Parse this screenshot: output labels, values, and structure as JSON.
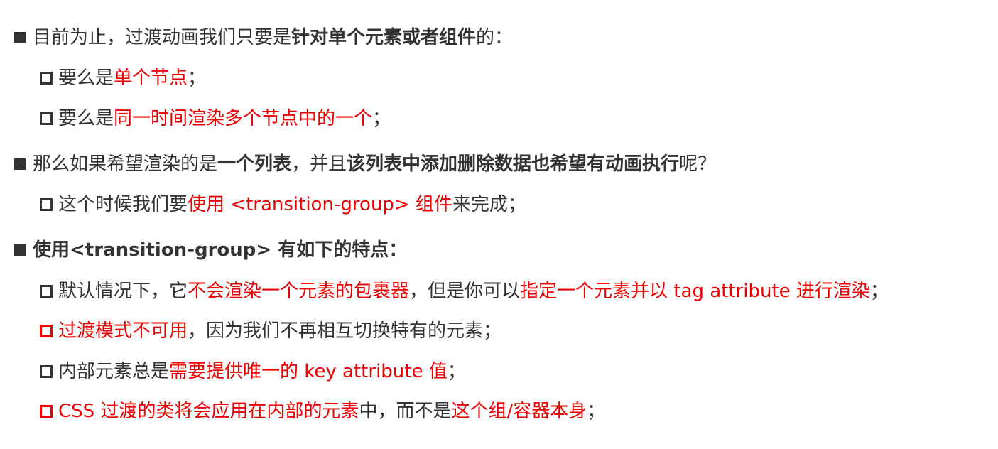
{
  "lines": [
    {
      "segments": [
        "目前为止，过渡动画我们只要是",
        "针对单个元素或者组件",
        "的："
      ]
    },
    {
      "segments": [
        "要么是",
        "单个节点",
        "；"
      ]
    },
    {
      "segments": [
        "要么是",
        "同一时间渲染多个节点中的一个",
        "；"
      ]
    },
    {
      "segments": [
        "那么如果希望渲染的是",
        "一个列表",
        "，并且",
        "该列表中添加删除数据也希望有动画执行",
        "呢？"
      ]
    },
    {
      "segments": [
        "这个时候我们要",
        "使用 <transition-group> 组件",
        "来完成；"
      ]
    },
    {
      "segments": [
        "使用<transition-group> 有如下的特点："
      ]
    },
    {
      "segments": [
        "默认情况下，它",
        "不会渲染一个元素的包裹器",
        "，但是你可以",
        "指定一个元素并以 tag attribute 进行渲染",
        "；"
      ]
    },
    {
      "segments": [
        "过渡模式不可用",
        "，因为我们不再相互切换特有的元素；"
      ]
    },
    {
      "segments": [
        "内部元素总是",
        "需要提供唯一的 key attribute 值",
        "；"
      ]
    },
    {
      "segments": [
        "CSS 过渡的类将会应用在内部的元素",
        "中，而不是",
        "这个组/容器本身",
        "；"
      ]
    }
  ],
  "colors": {
    "text": "#333333",
    "highlight": "#ee0000"
  }
}
